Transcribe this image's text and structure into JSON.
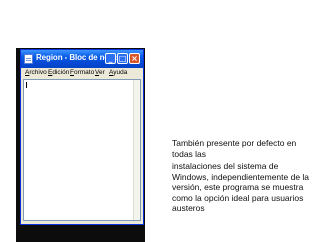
{
  "window": {
    "title": "Region - Bloc de notas",
    "menu": [
      "Archivo",
      "Edición",
      "Formato",
      "Ver",
      "Ayuda"
    ],
    "editor_text": ""
  },
  "caption": {
    "line1": "También presente por defecto en todas las",
    "line2": "instalaciones del sistema de Windows, independientemente de la versión, este programa se muestra como la opción ideal para usuarios austeros"
  },
  "colors": {
    "titlebar": "#0a5ee8",
    "close_button": "#d9552c",
    "window_frame": "#ece9d8"
  },
  "icons": {
    "app": "notepad-icon",
    "minimize": "minimize-icon",
    "maximize": "maximize-icon",
    "close": "close-icon"
  }
}
